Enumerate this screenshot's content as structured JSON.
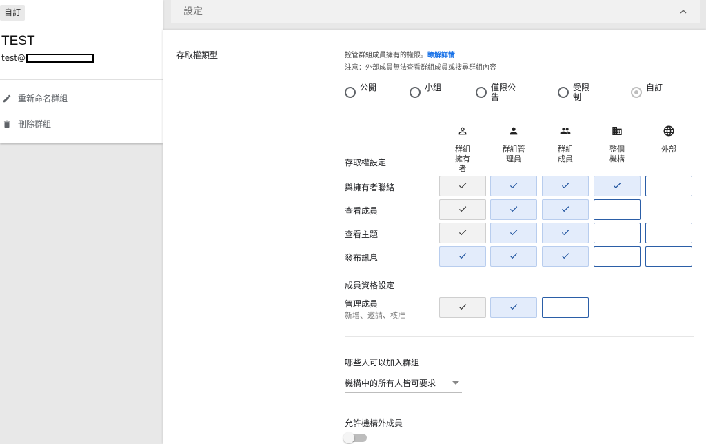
{
  "left": {
    "badge": "自訂",
    "group_name": "TEST",
    "email_prefix": "test@",
    "actions": [
      {
        "label": "重新命名群組",
        "icon": "pencil-icon"
      },
      {
        "label": "刪除群組",
        "icon": "trash-icon"
      }
    ]
  },
  "settings": {
    "title": "設定",
    "collapse_icon": "chevron-up-icon"
  },
  "access": {
    "section_label": "存取權類型",
    "description": "控管群組成員擁有的權限。",
    "learn_more": "瞭解詳情",
    "note": "注意：外部成員無法查看群組成員或搜尋群組內容",
    "types": [
      {
        "label": "公開",
        "selected": false
      },
      {
        "label": "小組",
        "selected": false
      },
      {
        "label": "僅限公告",
        "selected": false
      },
      {
        "label": "受限制",
        "selected": false
      },
      {
        "label": "自訂",
        "selected": true
      }
    ],
    "columns": [
      {
        "label": "群組擁有者",
        "icon": "person-outline-icon"
      },
      {
        "label": "群組管理員",
        "icon": "person-icon"
      },
      {
        "label": "群組成員",
        "icon": "people-icon"
      },
      {
        "label": "整個機構",
        "icon": "building-icon"
      },
      {
        "label": "外部",
        "icon": "globe-icon"
      }
    ],
    "settings_title": "存取權設定",
    "rows": [
      {
        "label": "與擁有者聯絡",
        "cells": [
          "grey-check",
          "blue-check",
          "blue-check",
          "blue-check",
          "empty"
        ]
      },
      {
        "label": "查看成員",
        "cells": [
          "grey-check",
          "blue-check",
          "blue-check",
          "empty",
          "none"
        ]
      },
      {
        "label": "查看主題",
        "cells": [
          "grey-check",
          "blue-check",
          "blue-check",
          "empty",
          "empty"
        ]
      },
      {
        "label": "發布訊息",
        "cells": [
          "blue-check",
          "blue-check",
          "blue-check",
          "empty",
          "empty"
        ]
      }
    ],
    "membership_title": "成員資格設定",
    "manage": {
      "label": "管理成員",
      "sub": "新增、邀請、核准",
      "cells": [
        "grey-check",
        "blue-check",
        "empty"
      ]
    }
  },
  "join": {
    "title": "哪些人可以加入群組",
    "value": "機構中的所有人皆可要求"
  },
  "external": {
    "title": "允許機構外成員",
    "enabled": false
  },
  "colors": {
    "link": "#1a73e8",
    "check_blue": "#1a4f9c",
    "check_grey": "#333333",
    "cell_blue": "#e3ecfb",
    "cell_border_empty": "#2b5ea7"
  }
}
